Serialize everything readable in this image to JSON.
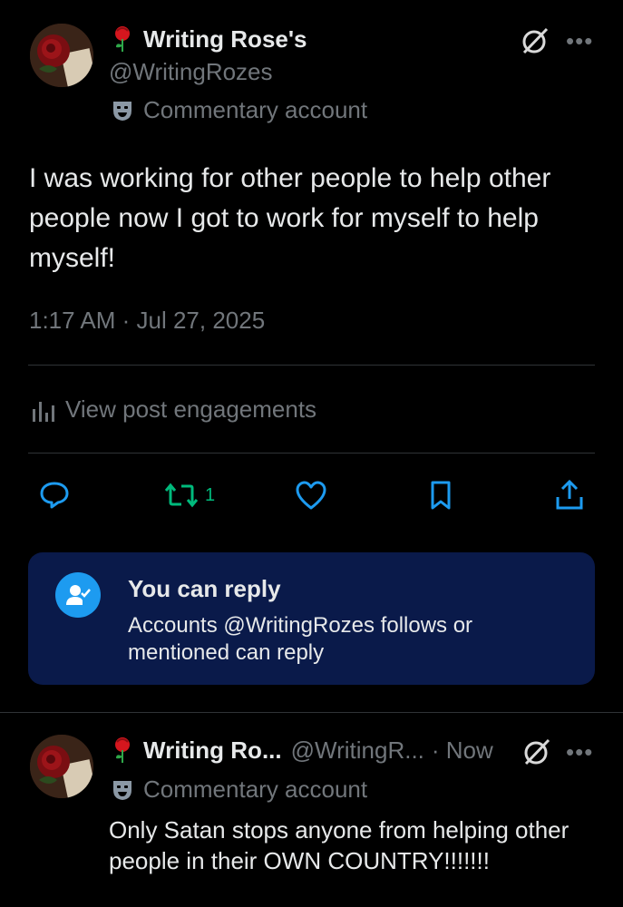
{
  "post": {
    "display_name": "Writing Rose's",
    "handle": "@WritingRozes",
    "label": "Commentary account",
    "text": "I was working for other people to help other people now I got to work for myself to help myself!",
    "timestamp": "1:17 AM · Jul 27, 2025",
    "engagements_label": "View post engagements",
    "repost_count": "1",
    "more_icon": "ellipsis-icon",
    "grok_icon": "grok-icon"
  },
  "reply_restriction": {
    "title": "You can reply",
    "description": "Accounts @WritingRozes follows or mentioned can reply"
  },
  "reply": {
    "display_name": "Writing Ro...",
    "handle": "@WritingR...",
    "time": "· Now",
    "label": "Commentary account",
    "text": "Only Satan stops anyone from helping other people in their OWN COUNTRY!!!!!!!"
  },
  "colors": {
    "background": "#000000",
    "text": "#e7e9ea",
    "muted": "#71767b",
    "repost_green": "#00ba7c",
    "accent_blue": "#1d9bf0",
    "reply_box": "#0a1a4a"
  }
}
